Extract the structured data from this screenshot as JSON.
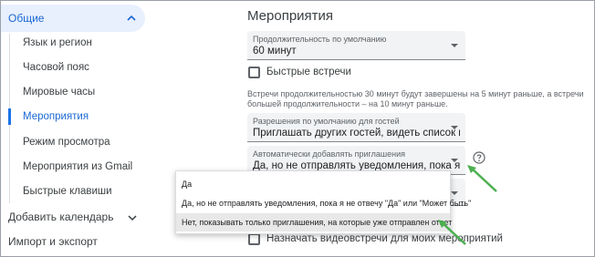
{
  "sidebar": {
    "top": {
      "label": "Общие"
    },
    "items": [
      {
        "label": "Язык и регион"
      },
      {
        "label": "Часовой пояс"
      },
      {
        "label": "Мировые часы"
      },
      {
        "label": "Мероприятия"
      },
      {
        "label": "Режим просмотра"
      },
      {
        "label": "Мероприятия из Gmail"
      },
      {
        "label": "Быстрые клавиши"
      }
    ],
    "sections": [
      {
        "label": "Добавить календарь"
      },
      {
        "label": "Импорт и экспорт"
      }
    ],
    "active_item": "Мероприятия"
  },
  "main": {
    "title": "Мероприятия",
    "duration": {
      "caption": "Продолжительность по умолчанию",
      "value": "60 минут"
    },
    "quick_meetings": {
      "label": "Быстрые встречи"
    },
    "note": "Встречи продолжительностью 30 минут будут завершены на 5 минут раньше, а встречи большей продолжительности – на 10 минут раньше.",
    "guest_permissions": {
      "caption": "Разрешения по умолчанию для гостей",
      "value": "Приглашать других гостей, видеть список пригл..."
    },
    "auto_add": {
      "caption": "Автоматически добавлять приглашения",
      "value": "Да, но не отправлять уведомления, пока я не о..."
    },
    "video_meetings": {
      "label": "Назначать видеовстречи для моих мероприятий"
    }
  },
  "dropdown": {
    "options": [
      {
        "label": "Да"
      },
      {
        "label": "Да, но не отправлять уведомления, пока я не отвечу \"Да\" или \"Может быть\""
      },
      {
        "label": "Нет, показывать только приглашения, на которые уже отправлен ответ"
      }
    ],
    "selected_index": 2
  },
  "colors": {
    "accent": "#1a73e8",
    "annotation_arrow": "#4caf50"
  },
  "icons": {
    "help": "help-circle-icon",
    "chevron": "chevron-up-icon"
  }
}
